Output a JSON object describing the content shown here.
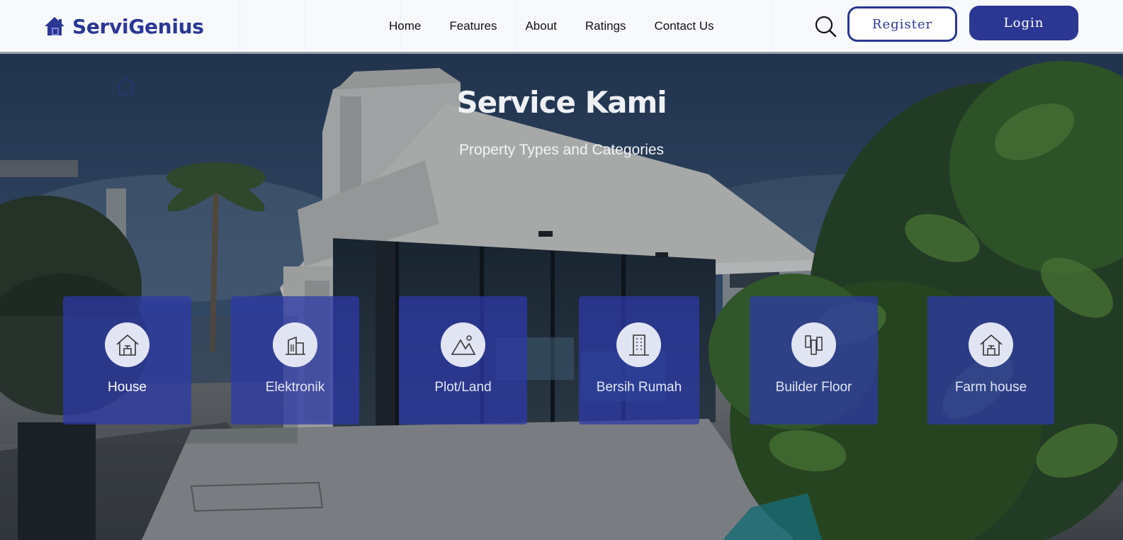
{
  "brand": {
    "name": "ServiGenius"
  },
  "nav": {
    "items": [
      "Home",
      "Features",
      "About",
      "Ratings",
      "Contact Us"
    ]
  },
  "header": {
    "register_label": "Register",
    "login_label": "Login"
  },
  "hero": {
    "title": "Service Kami",
    "subtitle": "Property Types and Categories",
    "cards": [
      {
        "label": "House",
        "icon": "house-icon"
      },
      {
        "label": "Elektronik",
        "icon": "building-icon"
      },
      {
        "label": "Plot/Land",
        "icon": "mountain-icon"
      },
      {
        "label": "Bersih Rumah",
        "icon": "tower-building-icon"
      },
      {
        "label": "Builder Floor",
        "icon": "columns-icon"
      },
      {
        "label": "Farm house",
        "icon": "farmhouse-icon"
      }
    ]
  },
  "colors": {
    "accent": "#2c3794",
    "card": "#2e3aa8",
    "card_icon_bg": "#e1e4f2"
  }
}
